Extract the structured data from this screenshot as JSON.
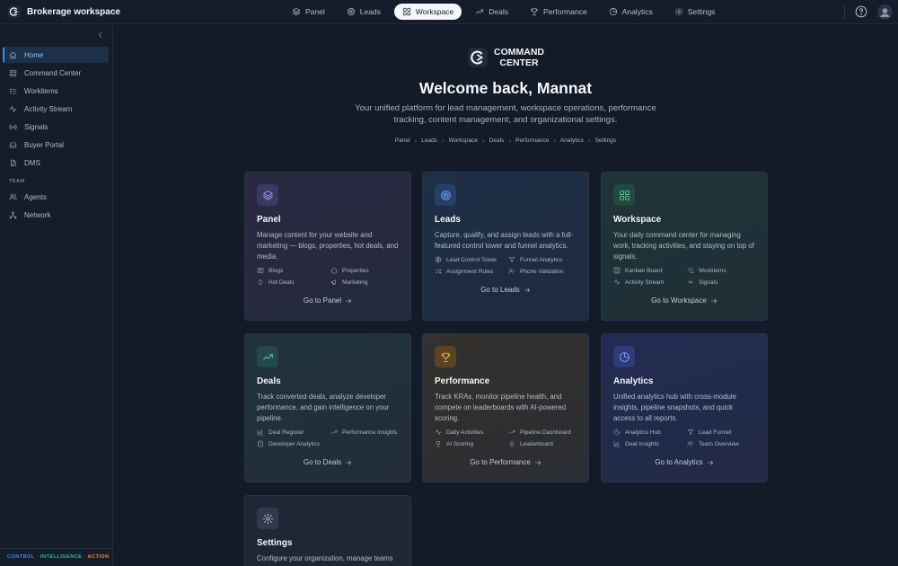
{
  "app": {
    "workspace_name": "Brokerage workspace"
  },
  "topnav": [
    {
      "label": "Panel",
      "icon": "layers-icon",
      "active": false
    },
    {
      "label": "Leads",
      "icon": "target-icon",
      "active": false
    },
    {
      "label": "Workspace",
      "icon": "grid-icon",
      "active": true
    },
    {
      "label": "Deals",
      "icon": "trending-up-icon",
      "active": false
    },
    {
      "label": "Performance",
      "icon": "trophy-icon",
      "active": false
    },
    {
      "label": "Analytics",
      "icon": "pie-chart-icon",
      "active": false
    },
    {
      "label": "Settings",
      "icon": "gear-icon",
      "active": false
    }
  ],
  "sidebar": {
    "items": [
      {
        "label": "Home",
        "icon": "home-icon",
        "active": true
      },
      {
        "label": "Command Center",
        "icon": "grid-icon"
      },
      {
        "label": "Workitems",
        "icon": "list-checks-icon"
      },
      {
        "label": "Activity Stream",
        "icon": "activity-icon"
      },
      {
        "label": "Signals",
        "icon": "radio-icon"
      },
      {
        "label": "Buyer Portal",
        "icon": "inbox-icon"
      },
      {
        "label": "DMS",
        "icon": "file-icon"
      }
    ],
    "team_heading": "TEAM",
    "team_items": [
      {
        "label": "Agents",
        "icon": "users-icon"
      },
      {
        "label": "Network",
        "icon": "network-icon"
      }
    ],
    "tagline": {
      "control": "CONTROL",
      "intelligence": "INTELLIGENCE",
      "action": "ACTION",
      "separator": "·"
    }
  },
  "hero": {
    "brand_line1": "COMMAND",
    "brand_line2": "CENTER",
    "welcome": "Welcome back, Mannat",
    "subtitle": "Your unified platform for lead management, workspace operations, performance tracking, content management, and organizational settings."
  },
  "breadcrumb": [
    "Panel",
    "Leads",
    "Workspace",
    "Deals",
    "Performance",
    "Analytics",
    "Settings"
  ],
  "cards": {
    "panel": {
      "title": "Panel",
      "description": "Manage content for your website and marketing — blogs, properties, hot deals, and media.",
      "links": [
        "Blogs",
        "Properties",
        "Hot Deals",
        "Marketing"
      ],
      "cta": "Go to Panel",
      "accent": "#9d8cff"
    },
    "leads": {
      "title": "Leads",
      "description": "Capture, qualify, and assign leads with a full-featured control tower and funnel analytics.",
      "links": [
        "Lead Control Tower",
        "Funnel Analytics",
        "Assignment Rules",
        "Phone Validation"
      ],
      "cta": "Go to Leads",
      "accent": "#6aa8ff"
    },
    "workspace": {
      "title": "Workspace",
      "description": "Your daily command center for managing work, tracking activities, and staying on top of signals.",
      "links": [
        "Kanban Board",
        "Workitems",
        "Activity Stream",
        "Signals"
      ],
      "cta": "Go to Workspace",
      "accent": "#3fd6a0"
    },
    "deals": {
      "title": "Deals",
      "description": "Track converted deals, analyze developer performance, and gain intelligence on your pipeline.",
      "links": [
        "Deal Register",
        "Performance Insights",
        "Developer Analytics"
      ],
      "cta": "Go to Deals",
      "accent": "#4fd1b5"
    },
    "performance": {
      "title": "Performance",
      "description": "Track KRAs, monitor pipeline health, and compete on leaderboards with AI-powered scoring.",
      "links": [
        "Daily Activities",
        "Pipeline Dashboard",
        "AI Scoring",
        "Leaderboard"
      ],
      "cta": "Go to Performance",
      "accent": "#f0b24a"
    },
    "analytics": {
      "title": "Analytics",
      "description": "Unified analytics hub with cross-module insights, pipeline snapshots, and quick access to all reports.",
      "links": [
        "Analytics Hub",
        "Lead Funnel",
        "Deal Insights",
        "Team Overview"
      ],
      "cta": "Go to Analytics",
      "accent": "#7f95ff"
    },
    "settings": {
      "title": "Settings",
      "description": "Configure your organization, manage teams",
      "accent": "#c3cad6"
    }
  }
}
